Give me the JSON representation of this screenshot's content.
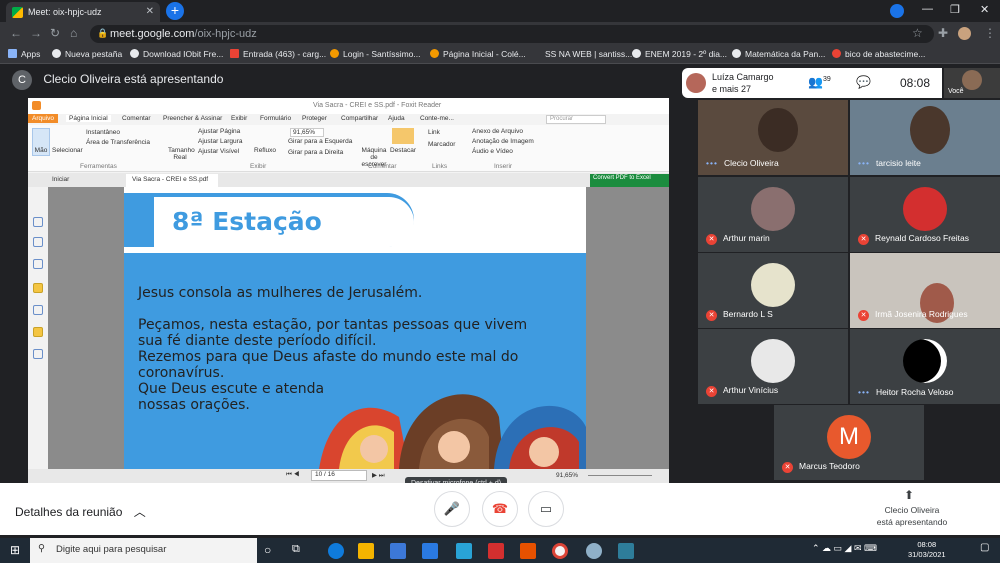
{
  "browser": {
    "tab_title": "Meet: oix-hpjc-udz",
    "url_host": "meet.google.com",
    "url_path": "/oix-hpjc-udz",
    "bookmarks": [
      "Apps",
      "Nueva pestaña",
      "Download IObit Fre...",
      "Entrada (463) - carg...",
      "Login - Santíssimo...",
      "Página Inicial - Colé...",
      "SS NA WEB | santiss...",
      "ENEM 2019 - 2º dia...",
      "Matemática da Pan...",
      "bico de abastecime..."
    ]
  },
  "meet": {
    "presenter_banner": "Clecio Oliveira está apresentando",
    "presenter_initial": "C",
    "top_card": {
      "name": "Luíza Camargo",
      "more": "e mais 27"
    },
    "people_count": "39",
    "clock": "08:08",
    "self_label": "Você",
    "participants": [
      {
        "name": "Clecio Oliveira",
        "muted": false
      },
      {
        "name": "tarcisio leite",
        "muted": false
      },
      {
        "name": "Arthur marin",
        "muted": true
      },
      {
        "name": "Reynald Cardoso Freitas",
        "muted": true
      },
      {
        "name": "Bernardo L S",
        "muted": true
      },
      {
        "name": "Irmã Josenira Rodrigues",
        "muted": true
      },
      {
        "name": "Arthur Vinícius",
        "muted": true
      },
      {
        "name": "Heitor Rocha Veloso",
        "muted": false
      },
      {
        "name": "Marcus Teodoro",
        "muted": true,
        "initial": "M"
      }
    ],
    "details_label": "Detalhes da reunião",
    "tooltip": "Desativar microfone (ctrl + d)",
    "presenting_label_1": "Clecio Oliveira",
    "presenting_label_2": "está apresentando"
  },
  "reader": {
    "title": "Via Sacra - CREI e SS.pdf - Foxit Reader",
    "menu": [
      "Arquivo",
      "Página Inicial",
      "Comentar",
      "Preencher & Assinar",
      "Exibir",
      "Formulário",
      "Proteger",
      "Compartilhar",
      "Ajuda",
      "Conte-me..."
    ],
    "search_placeholder": "Procurar",
    "ribbon": {
      "mao": "Mão",
      "selecionar": "Selecionar",
      "instantaneo": "Instantâneo",
      "area": "Área de Transferência",
      "ferramentas": "Ferramentas",
      "tamanho": "Tamanho Real",
      "ajustar_pagina": "Ajustar Página",
      "ajustar_largura": "Ajustar Largura",
      "ajustar_visivel": "Ajustar Visível",
      "refluxo": "Refluxo",
      "zoom": "91,65%",
      "girar_esq": "Girar para a Esquerda",
      "girar_dir": "Girar para a Direita",
      "exibir": "Exibir",
      "maquina": "Máquina de escrever",
      "destacar": "Destacar",
      "comentar": "Comentar",
      "link": "Link",
      "marcador": "Marcador",
      "links": "Links",
      "anexo": "Anexo de Arquivo",
      "anotacao": "Anotação de Imagem",
      "audio": "Áudio e Vídeo",
      "inserir": "Inserir"
    },
    "doc_tabs": [
      "Iniciar",
      "Via Sacra - CREI e SS.pdf"
    ],
    "convert_badge": "Convert PDF to Excel",
    "page_indicator": "10 / 16",
    "status_zoom": "91,65%",
    "page": {
      "station": "8ª Estação",
      "line1": "Jesus consola as mulheres de Jerusalém.",
      "line2": "Peçamos, nesta estação, por tantas pessoas que vivem",
      "line3": "sua fé diante deste período difícil.",
      "line4": "Rezemos para que Deus afaste do mundo este mal do",
      "line5": "coronavírus.",
      "line6": "Que Deus escute e atenda",
      "line7": "nossas orações."
    }
  },
  "taskbar": {
    "search_placeholder": "Digite aqui para pesquisar",
    "time": "08:08",
    "date": "31/03/2021"
  }
}
